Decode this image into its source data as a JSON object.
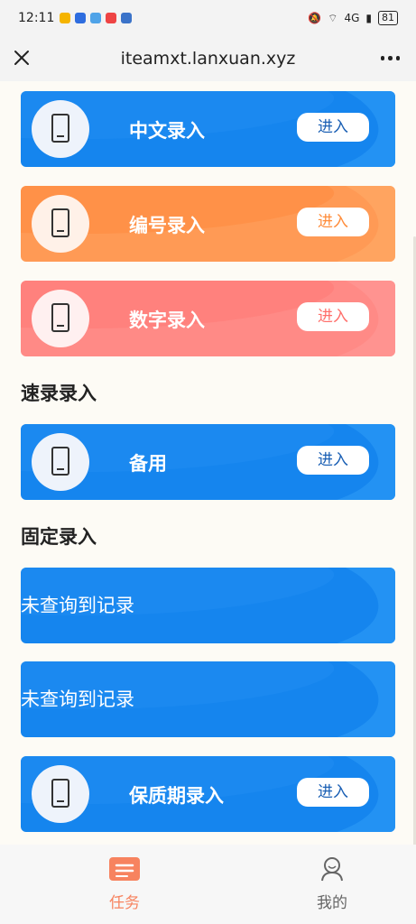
{
  "status_bar": {
    "time": "12:11",
    "signal": "4G",
    "battery": "81"
  },
  "header": {
    "url": "iteamxt.lanxuan.xyz"
  },
  "cards_top": [
    {
      "label": "中文录入",
      "button": "进入",
      "theme": "blue"
    },
    {
      "label": "编号录入",
      "button": "进入",
      "theme": "orange"
    },
    {
      "label": "数字录入",
      "button": "进入",
      "theme": "pink"
    }
  ],
  "section_speed": {
    "title": "速录录入",
    "cards": [
      {
        "label": "备用",
        "button": "进入"
      }
    ]
  },
  "section_fixed": {
    "title": "固定录入",
    "empty_1": "未查询到记录",
    "empty_2": "未查询到记录",
    "cards": [
      {
        "label": "保质期录入",
        "button": "进入"
      }
    ]
  },
  "tabbar": {
    "tabs": [
      {
        "label": "任务",
        "icon": "task-list-icon",
        "active": true
      },
      {
        "label": "我的",
        "icon": "user-icon",
        "active": false
      }
    ],
    "active_color": "#f7835f"
  },
  "colors": {
    "blue": "#1585ee",
    "orange": "#ff9a55",
    "pink": "#ff8a86"
  }
}
